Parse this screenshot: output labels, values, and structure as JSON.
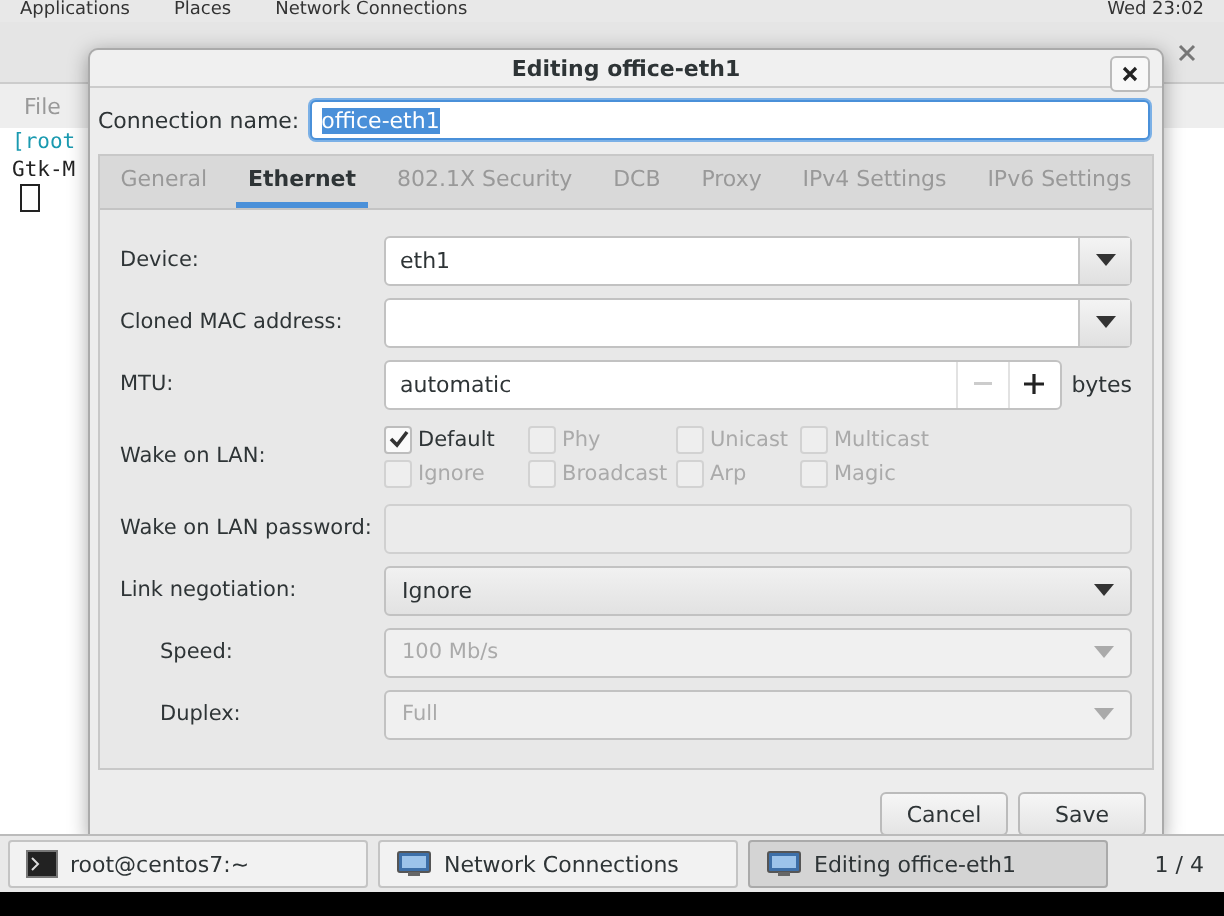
{
  "top_bar": {
    "menus": [
      "Applications",
      "Places",
      "Network Connections"
    ],
    "clock": "Wed 23:02"
  },
  "terminal": {
    "menu": "File",
    "lines": [
      "[root",
      "Gtk-M"
    ]
  },
  "dialog": {
    "title": "Editing office-eth1",
    "name_label": "Connection name:",
    "name_value": "office-eth1",
    "tabs": [
      {
        "label": "General",
        "selected": false
      },
      {
        "label": "Ethernet",
        "selected": true
      },
      {
        "label": "802.1X Security",
        "selected": false
      },
      {
        "label": "DCB",
        "selected": false
      },
      {
        "label": "Proxy",
        "selected": false
      },
      {
        "label": "IPv4 Settings",
        "selected": false
      },
      {
        "label": "IPv6 Settings",
        "selected": false
      }
    ],
    "rows": [
      {
        "kind": "combo",
        "label": "Device:",
        "value": "eth1"
      },
      {
        "kind": "combo",
        "label": "Cloned MAC address:"
      },
      {
        "kind": "spin",
        "label": "MTU:",
        "value": "automatic",
        "unit": "bytes"
      },
      {
        "kind": "checks",
        "label": "Wake on LAN:",
        "options": [
          {
            "label": "Default",
            "checked": true,
            "disabled": false
          },
          {
            "label": "Phy",
            "checked": false,
            "disabled": true
          },
          {
            "label": "Unicast",
            "checked": false,
            "disabled": true
          },
          {
            "label": "Multicast",
            "checked": false,
            "disabled": true
          },
          {
            "label": "Ignore",
            "checked": false,
            "disabled": true
          },
          {
            "label": "Broadcast",
            "checked": false,
            "disabled": true
          },
          {
            "label": "Arp",
            "checked": false,
            "disabled": true
          },
          {
            "label": "Magic",
            "checked": false,
            "disabled": true
          }
        ]
      },
      {
        "kind": "entry",
        "label": "Wake on LAN password:",
        "disabled": true
      },
      {
        "kind": "dropdown",
        "label": "Link negotiation:",
        "value": "Ignore",
        "disabled": false
      },
      {
        "kind": "dropdown",
        "label": "Speed:",
        "value": "100 Mb/s",
        "disabled": true,
        "indented": true
      },
      {
        "kind": "dropdown",
        "label": "Duplex:",
        "value": "Full",
        "disabled": true,
        "indented": true
      }
    ],
    "buttons": [
      "Cancel",
      "Save"
    ]
  },
  "taskbar": {
    "items": [
      {
        "label": "root@centos7:~",
        "kind": "terminal",
        "selected": false
      },
      {
        "label": "Network Connections",
        "kind": "network",
        "selected": false
      },
      {
        "label": "Editing office-eth1",
        "kind": "network",
        "selected": true
      }
    ],
    "pager": "1 / 4"
  }
}
